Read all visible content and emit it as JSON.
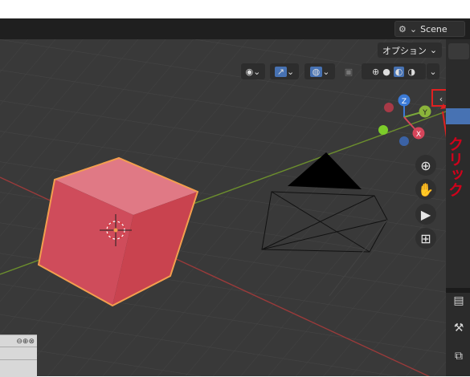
{
  "header": {
    "scene_label": "Scene"
  },
  "viewport": {
    "options_label": "オプション",
    "axis_labels": {
      "z": "Z",
      "y": "Y",
      "x": "X"
    },
    "annotation_text": "クリック",
    "highlight_color": "#e02020",
    "selected_object_color": "#e0505f",
    "selected_outline_color": "#f4a04a"
  },
  "icons": {
    "visibility": "eye-icon",
    "gizmo": "gizmo-arrow-icon",
    "overlay": "overlay-icon",
    "xray": "xray-icon",
    "shading_wire": "wireframe-shading-icon",
    "shading_solid": "solid-shading-icon",
    "shading_material": "material-shading-icon",
    "shading_render": "render-shading-icon",
    "zoom": "zoom-icon",
    "pan": "hand-icon",
    "camera": "camera-icon",
    "grid": "grid-icon"
  }
}
